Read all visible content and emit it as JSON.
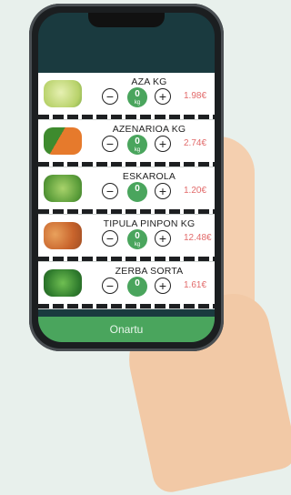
{
  "products": [
    {
      "name": "AZA KG",
      "qty": "0",
      "unit": "kg",
      "price": "1.98€",
      "icon": "cabbage-image"
    },
    {
      "name": "AZENARIOA KG",
      "qty": "0",
      "unit": "kg",
      "price": "2.74€",
      "icon": "carrot-image"
    },
    {
      "name": "ESKAROLA",
      "qty": "0",
      "unit": "",
      "price": "1.20€",
      "icon": "endive-image"
    },
    {
      "name": "TIPULA PINPON KG",
      "qty": "0",
      "unit": "kg",
      "price": "12.48€",
      "icon": "onion-image"
    },
    {
      "name": "ZERBA SORTA",
      "qty": "0",
      "unit": "",
      "price": "1.61€",
      "icon": "chard-image"
    }
  ],
  "footer": {
    "button_label": "Onartu"
  },
  "colors": {
    "accent": "#4aa55d",
    "price": "#e26b6b",
    "screen_bg": "#1a3a3f"
  }
}
